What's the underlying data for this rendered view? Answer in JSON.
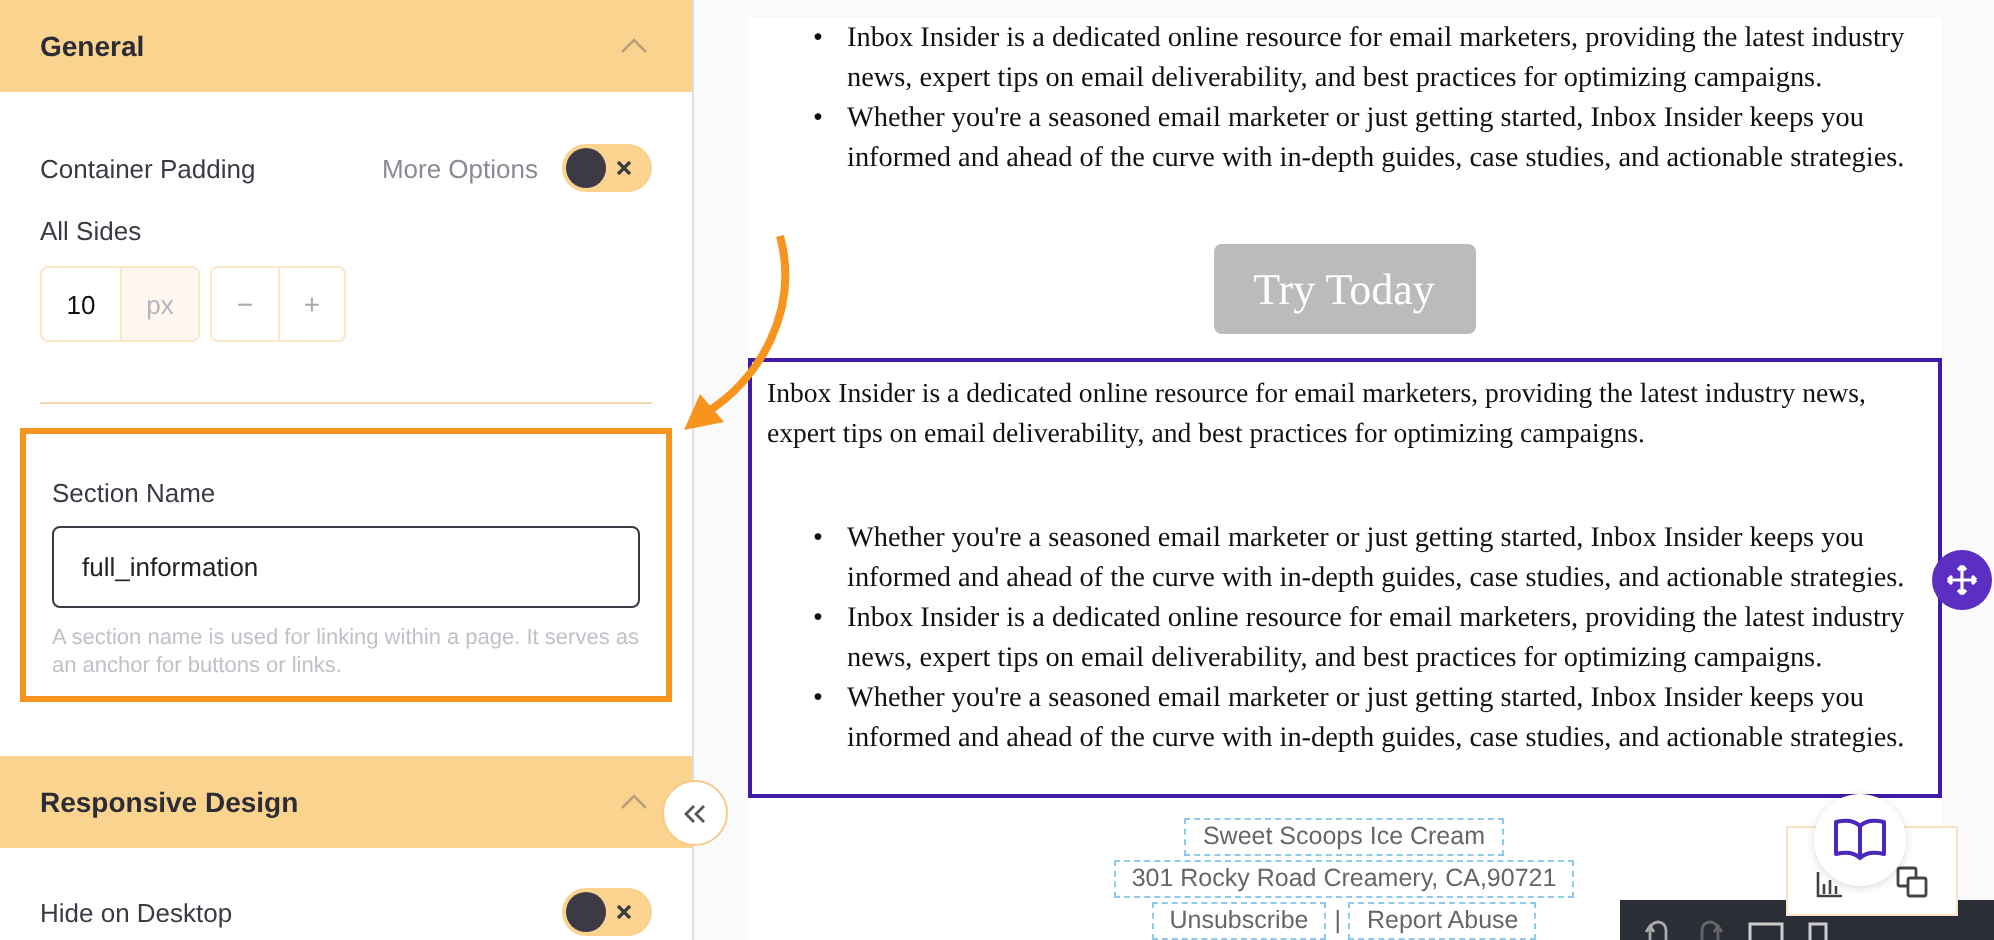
{
  "sidebar": {
    "sections": [
      {
        "title": "General",
        "expanded": true,
        "padding": {
          "label": "Container Padding",
          "more_options": "More Options",
          "toggle_on": false,
          "sides_label": "All Sides",
          "value": "10",
          "unit": "px",
          "minus": "−",
          "plus": "+"
        },
        "section_name": {
          "label": "Section Name",
          "value": "full_information",
          "help": "A section name is used for linking within a page. It serves as an anchor for buttons or links.",
          "highlighted": true
        }
      },
      {
        "title": "Responsive Design",
        "expanded": true,
        "toggles": [
          {
            "label": "Hide on Desktop",
            "on": false
          }
        ]
      }
    ]
  },
  "canvas": {
    "bullet": "•",
    "top_list": [
      "Inbox Insider is a dedicated online resource for email marketers, providing the latest industry news, expert tips on email deliverability, and best practices for optimizing campaigns.",
      "Whether you're a seasoned email marketer or just getting started, Inbox Insider keeps you informed and ahead of the curve with in-depth guides, case studies, and actionable strategies."
    ],
    "button": "Try Today",
    "selected_block": {
      "selected": true,
      "paragraph": "Inbox Insider is a dedicated online resource for email marketers, providing the latest industry news, expert tips on email deliverability, and best practices for optimizing campaigns.",
      "list": [
        "Whether you're a seasoned email marketer or just getting started, Inbox Insider keeps you informed and ahead of the curve with in-depth guides, case studies, and actionable strategies.",
        "Inbox Insider is a dedicated online resource for email marketers, providing the latest industry news, expert tips on email deliverability, and best practices for optimizing campaigns.",
        "Whether you're a seasoned email marketer or just getting started, Inbox Insider keeps you informed and ahead of the curve with in-depth guides, case studies, and actionable strategies."
      ]
    },
    "footer": {
      "company": "Sweet Scoops Ice Cream",
      "address": "301 Rocky Road Creamery, CA,90721",
      "links": [
        "Unsubscribe",
        "Report Abuse"
      ],
      "separator": "|"
    }
  }
}
